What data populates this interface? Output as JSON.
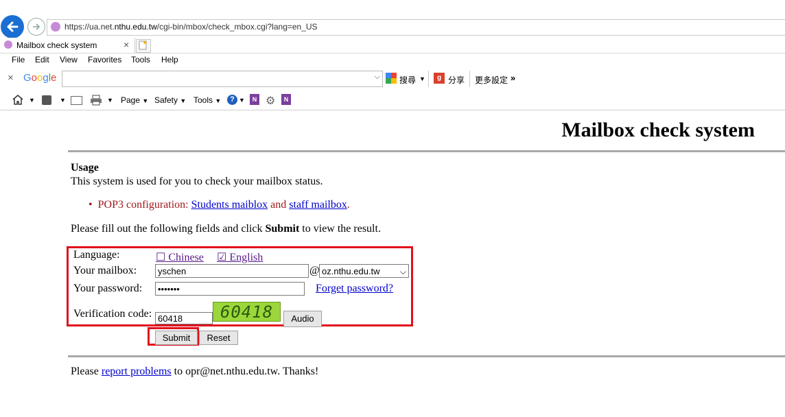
{
  "browser": {
    "url_prefix": "https://ua.net.",
    "url_domain": "nthu.edu.tw",
    "url_suffix": "/cgi-bin/mbox/check_mbox.cgi?lang=en_US",
    "tab_title": "Mailbox check system",
    "menu": [
      "File",
      "Edit",
      "View",
      "Favorites",
      "Tools",
      "Help"
    ],
    "google_logo": "Google",
    "search_label": "搜尋",
    "share_label": "分享",
    "more_settings": "更多設定",
    "cmd": {
      "page": "Page",
      "safety": "Safety",
      "tools": "Tools"
    }
  },
  "page": {
    "title": "Mailbox check system",
    "usage_heading": "Usage",
    "usage_text": "This system is used for you to check your mailbox status.",
    "pop3_prefix": "POP3 configuration: ",
    "students_link": "Students maiblox",
    "and_text": " and ",
    "staff_link": "staff mailbox",
    "period": ".",
    "instructions_prefix": "Please fill out the following fields and click ",
    "instructions_bold": "Submit",
    "instructions_suffix": " to view the result."
  },
  "form": {
    "language_label": "Language:",
    "lang_chinese": "☐ Chinese",
    "lang_english": "☑ English",
    "mailbox_label": "Your mailbox:",
    "mailbox_value": "yschen",
    "at_sign": "@",
    "domain_value": "oz.nthu.edu.tw",
    "password_label": "Your password:",
    "password_value": "•••••••",
    "forget_password": "Forget password?",
    "verification_label": "Verification code:",
    "verification_value": "60418",
    "captcha_text": "60418",
    "audio_button": "Audio",
    "submit_button": "Submit",
    "reset_button": "Reset"
  },
  "footer": {
    "prefix": "Please ",
    "link": "report problems",
    "suffix": " to opr@net.nthu.edu.tw. Thanks!"
  },
  "colors": {
    "highlight_red": "#e0101c",
    "link_blue": "#0000cc",
    "pop3_red": "#a0181c",
    "captcha_green": "#9cd63a"
  }
}
